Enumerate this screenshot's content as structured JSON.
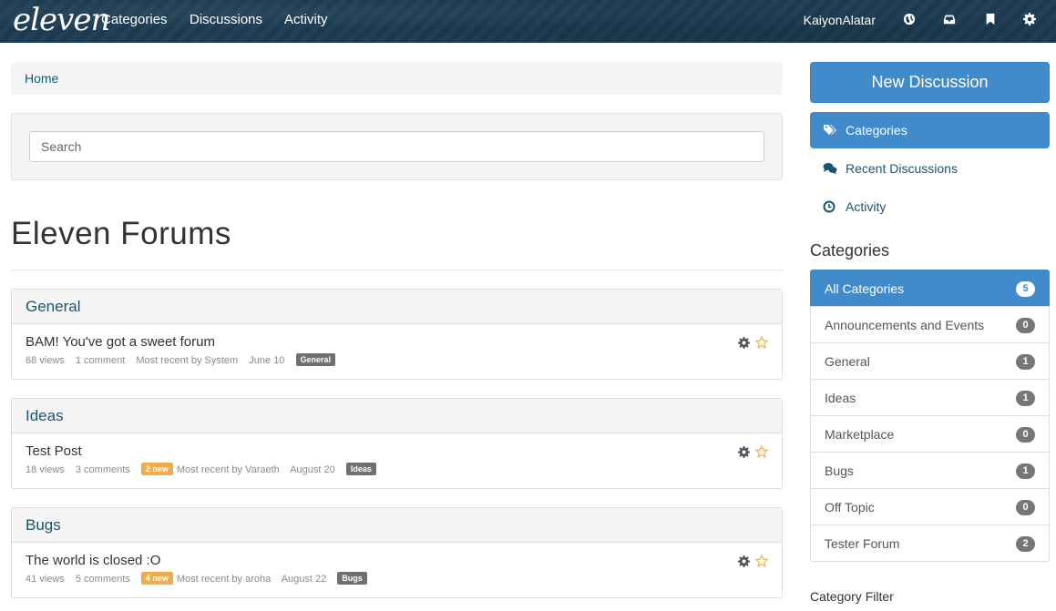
{
  "topbar": {
    "logo": "eleven",
    "nav": [
      "Categories",
      "Discussions",
      "Activity"
    ],
    "user": "KaiyonAlatar",
    "icons": [
      "globe-icon",
      "inbox-icon",
      "bookmark-icon",
      "gear-icon"
    ]
  },
  "breadcrumb": {
    "home": "Home"
  },
  "search": {
    "placeholder": "Search"
  },
  "page": {
    "title": "Eleven Forums"
  },
  "categories_main": [
    {
      "name": "General",
      "discussion": {
        "title": "BAM! You've got a sweet forum",
        "views": "68 views",
        "comments": "1 comment",
        "new": "",
        "recent": "Most recent by System",
        "date": "June 10",
        "tag": "General"
      }
    },
    {
      "name": "Ideas",
      "discussion": {
        "title": "Test Post",
        "views": "18 views",
        "comments": "3 comments",
        "new": "2 new",
        "recent": "Most recent by Varaeth",
        "date": "August 20",
        "tag": "Ideas"
      }
    },
    {
      "name": "Bugs",
      "discussion": {
        "title": "The world is closed :O",
        "views": "41 views",
        "comments": "5 comments",
        "new": "4 new",
        "recent": "Most recent by aroha",
        "date": "August 22",
        "tag": "Bugs"
      }
    }
  ],
  "sidebar": {
    "new_discussion": "New Discussion",
    "nav": [
      {
        "label": "Categories",
        "icon": "tags-icon"
      },
      {
        "label": "Recent Discussions",
        "icon": "comments-icon"
      },
      {
        "label": "Activity",
        "icon": "clock-icon"
      }
    ],
    "categories_heading": "Categories",
    "category_list": [
      {
        "name": "All Categories",
        "count": "5"
      },
      {
        "name": "Announcements and Events",
        "count": "0"
      },
      {
        "name": "General",
        "count": "1"
      },
      {
        "name": "Ideas",
        "count": "1"
      },
      {
        "name": "Marketplace",
        "count": "0"
      },
      {
        "name": "Bugs",
        "count": "1"
      },
      {
        "name": "Off Topic",
        "count": "0"
      },
      {
        "name": "Tester Forum",
        "count": "2"
      }
    ],
    "filter_label": "Category Filter"
  },
  "colors": {
    "brand_blue": "#428bca",
    "link": "#18566f",
    "topbar": "#1d3c52",
    "new_badge": "#f0ad4e",
    "star": "#f0ad4e"
  }
}
